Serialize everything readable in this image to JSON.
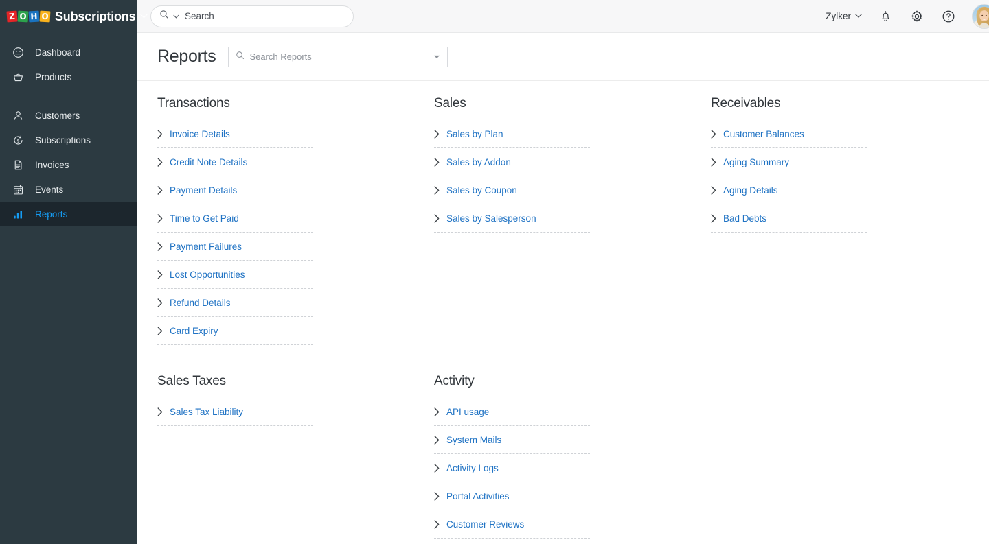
{
  "brand": {
    "logo_letters": [
      "Z",
      "O",
      "H",
      "O"
    ],
    "logo_colors": [
      "#e42527",
      "#2ca24c",
      "#1a73c0",
      "#f9b21d"
    ],
    "product_name": "Subscriptions",
    "caret": "⌄"
  },
  "sidebar": {
    "items": [
      {
        "label": "Dashboard",
        "icon": "dashboard-gauge-icon",
        "active": false
      },
      {
        "label": "Products",
        "icon": "basket-icon",
        "active": false
      },
      {
        "label": "Customers",
        "icon": "user-icon",
        "active": false
      },
      {
        "label": "Subscriptions",
        "icon": "recurring-dollar-icon",
        "active": false
      },
      {
        "label": "Invoices",
        "icon": "document-icon",
        "active": false
      },
      {
        "label": "Events",
        "icon": "calendar-icon",
        "active": false
      },
      {
        "label": "Reports",
        "icon": "bar-chart-icon",
        "active": true
      }
    ]
  },
  "topbar": {
    "search": {
      "placeholder": "Search",
      "value": ""
    },
    "org_name": "Zylker",
    "org_caret": "⌄",
    "icons": [
      "notification-bell-icon",
      "settings-gear-icon",
      "help-question-icon"
    ],
    "avatar": "user-avatar"
  },
  "page": {
    "title": "Reports",
    "search": {
      "placeholder": "Search Reports",
      "value": ""
    }
  },
  "sections": {
    "top": [
      {
        "title": "Transactions",
        "items": [
          "Invoice Details",
          "Credit Note Details",
          "Payment Details",
          "Time to Get Paid",
          "Payment Failures",
          "Lost Opportunities",
          "Refund Details",
          "Card Expiry"
        ]
      },
      {
        "title": "Sales",
        "items": [
          "Sales by Plan",
          "Sales by Addon",
          "Sales by Coupon",
          "Sales by Salesperson"
        ]
      },
      {
        "title": "Receivables",
        "items": [
          "Customer Balances",
          "Aging Summary",
          "Aging Details",
          "Bad Debts"
        ]
      }
    ],
    "bottom": [
      {
        "title": "Sales Taxes",
        "items": [
          "Sales Tax Liability"
        ]
      },
      {
        "title": "Activity",
        "items": [
          "API usage",
          "System Mails",
          "Activity Logs",
          "Portal Activities",
          "Customer Reviews"
        ]
      }
    ]
  },
  "colors": {
    "sidebar_bg": "#2c3a41",
    "sidebar_active_bg": "#1c262d",
    "accent_link": "#2073c4",
    "accent_active": "#159cf3",
    "topbar_bg": "#f7f7f8"
  }
}
